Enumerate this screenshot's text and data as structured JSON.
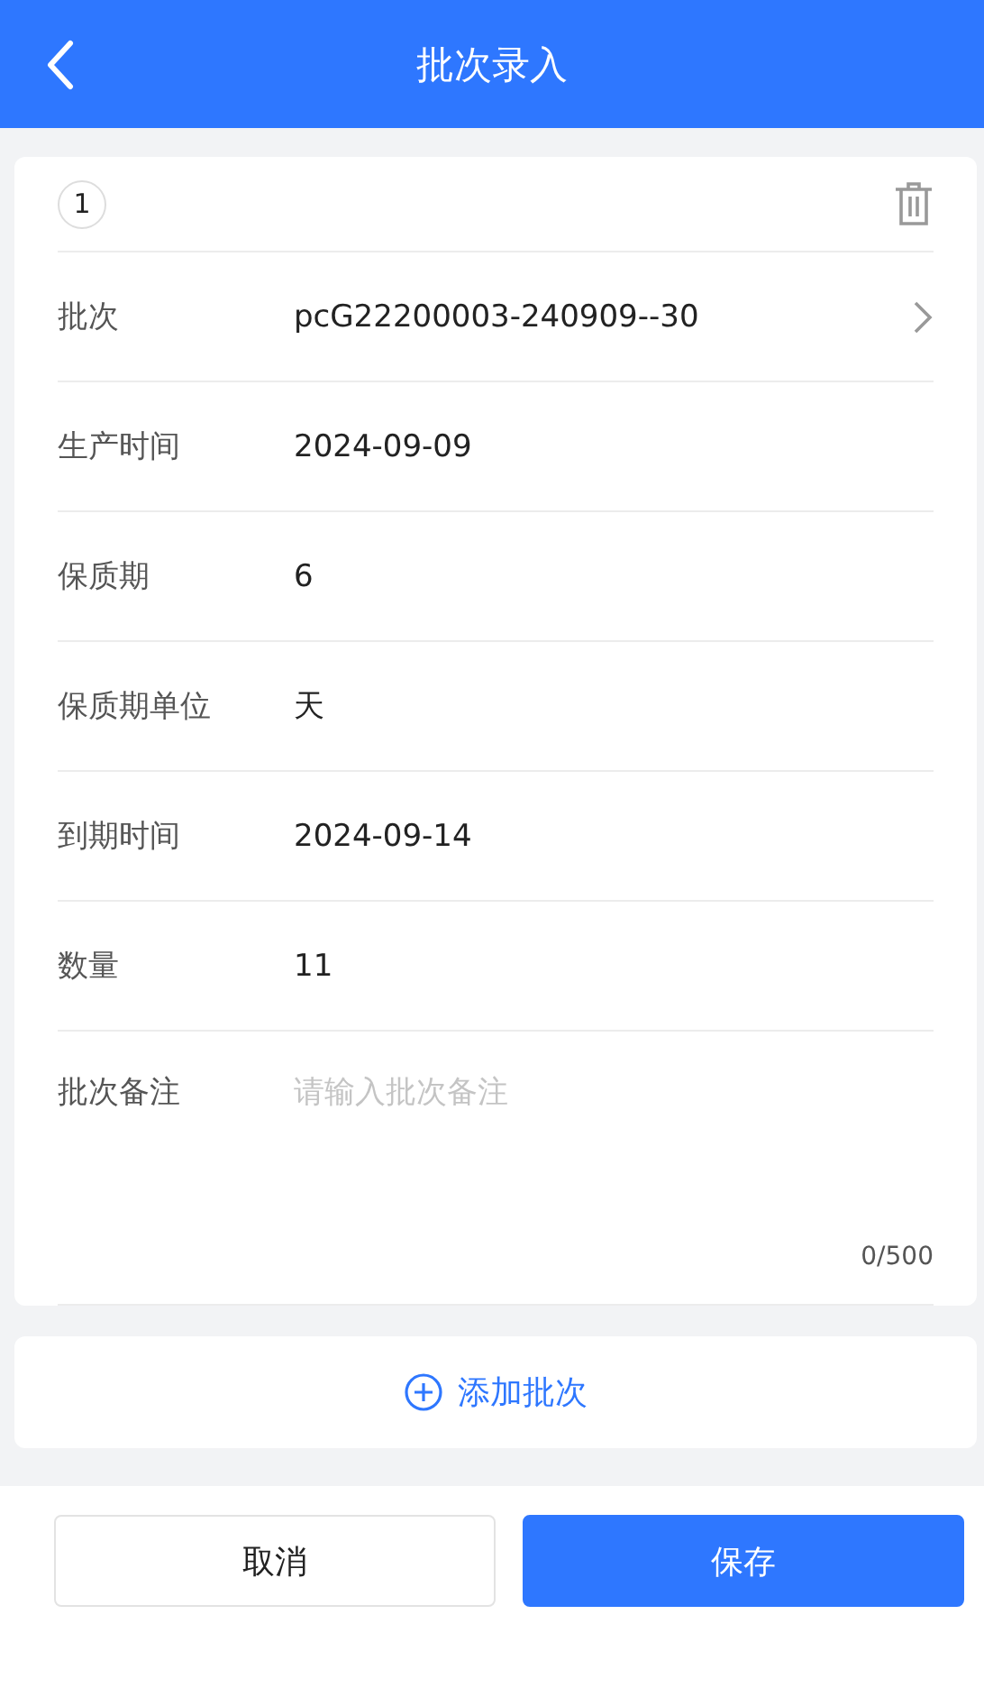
{
  "header": {
    "title": "批次录入"
  },
  "batches": [
    {
      "index": "1",
      "fields": [
        {
          "kind": "select",
          "label": "批次",
          "value": "pcG22200003-240909--30"
        },
        {
          "kind": "text",
          "label": "生产时间",
          "value": "2024-09-09"
        },
        {
          "kind": "text",
          "label": "保质期",
          "value": "6"
        },
        {
          "kind": "text",
          "label": "保质期单位",
          "value": "天"
        },
        {
          "kind": "text",
          "label": "到期时间",
          "value": "2024-09-14"
        },
        {
          "kind": "text",
          "label": "数量",
          "value": "11"
        }
      ],
      "remark": {
        "label": "批次备注",
        "placeholder": "请输入批次备注",
        "counter": "0/500"
      }
    }
  ],
  "add_button": "添加批次",
  "buttons": {
    "cancel": "取消",
    "save": "保存"
  }
}
